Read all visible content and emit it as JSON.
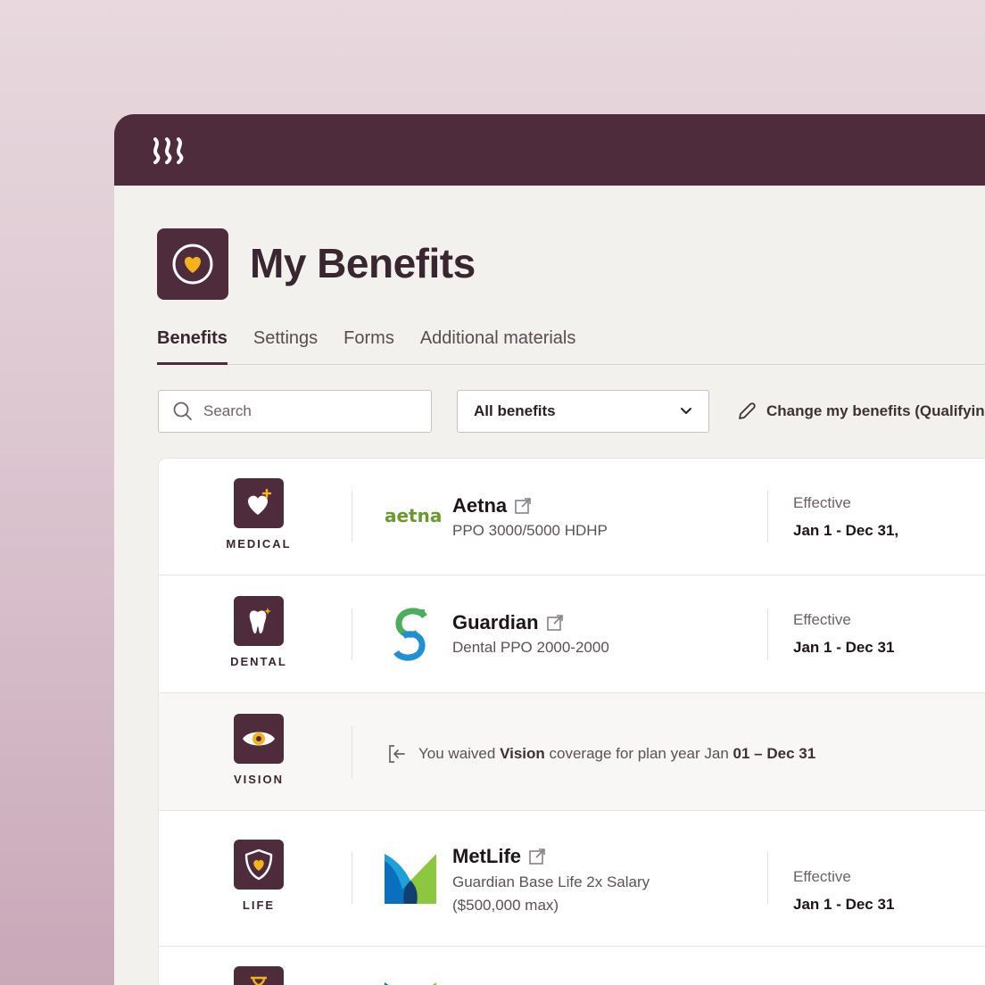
{
  "page": {
    "title": "My Benefits"
  },
  "tabs": [
    {
      "label": "Benefits",
      "active": true
    },
    {
      "label": "Settings",
      "active": false
    },
    {
      "label": "Forms",
      "active": false
    },
    {
      "label": "Additional materials",
      "active": false
    }
  ],
  "toolbar": {
    "search_placeholder": "Search",
    "filter_selected": "All benefits",
    "change_link": "Change my benefits (Qualifying"
  },
  "benefits": [
    {
      "category": "MEDICAL",
      "icon": "heart-plus-icon",
      "carrier": "Aetna",
      "carrier_logo_text": "aetna",
      "plan": "PPO 3000/5000 HDHP",
      "effective_label": "Effective",
      "effective_dates": "Jan 1 - Dec 31,"
    },
    {
      "category": "DENTAL",
      "icon": "tooth-icon",
      "carrier": "Guardian",
      "plan": "Dental PPO 2000-2000",
      "effective_label": "Effective",
      "effective_dates": "Jan 1 - Dec 31"
    },
    {
      "category": "VISION",
      "icon": "eye-icon",
      "waived_prefix": "You waived",
      "waived_benefit": "Vision",
      "waived_middle": "coverage for plan year Jan",
      "waived_dates": "01 – Dec 31"
    },
    {
      "category": "LIFE",
      "icon": "shield-heart-icon",
      "carrier": "MetLife",
      "plan_line1": "Guardian Base Life 2x Salary",
      "plan_line2": "($500,000 max)",
      "effective_label": "Effective",
      "effective_dates": "Jan 1 - Dec 31"
    }
  ],
  "colors": {
    "brand": "#4f2c3c",
    "accent": "#f5b21b",
    "background": "#f3f1ee"
  }
}
